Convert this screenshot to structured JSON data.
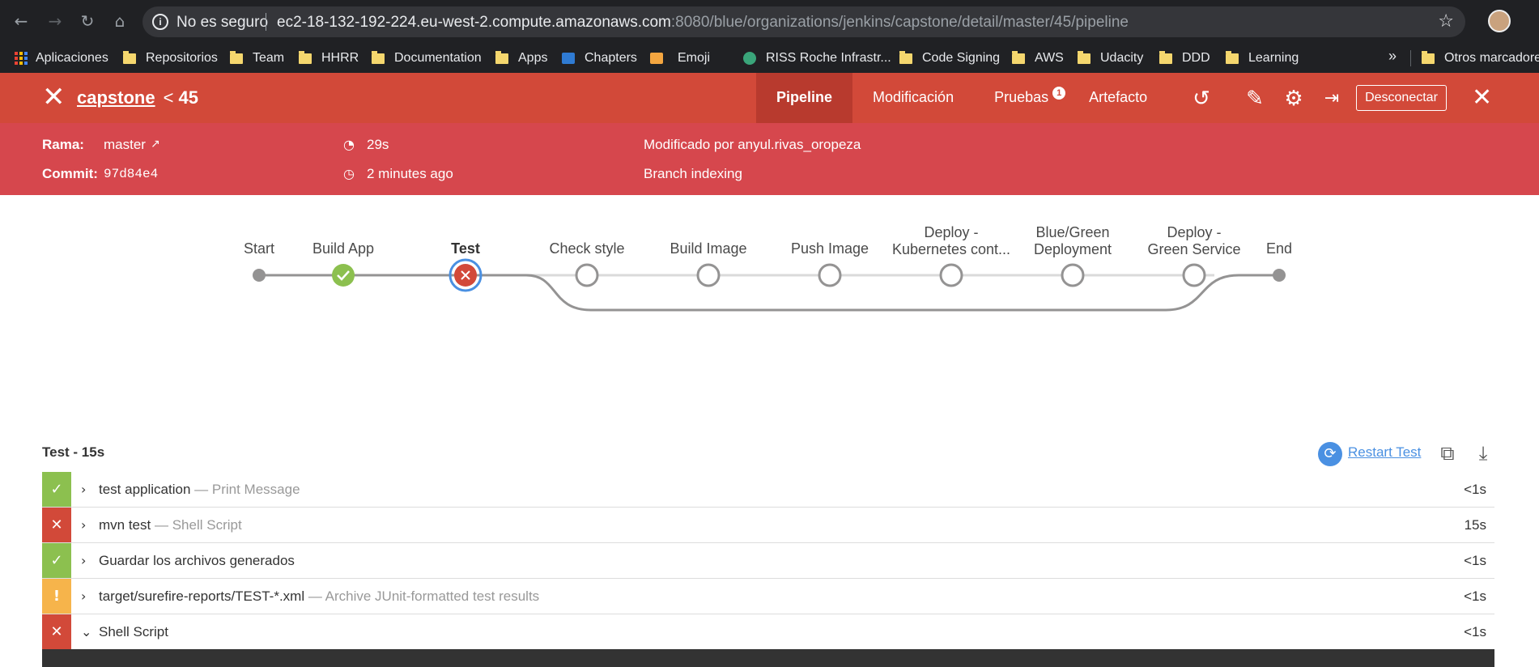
{
  "browser": {
    "insecure_label": "No es seguro",
    "url_host": "ec2-18-132-192-224.eu-west-2.compute.amazonaws.com",
    "url_path": ":8080/blue/organizations/jenkins/capstone/detail/master/45/pipeline",
    "bookmarks": [
      {
        "label": "Aplicaciones",
        "icon": "apps-grid-icon"
      },
      {
        "label": "Repositorios",
        "icon": "folder-icon"
      },
      {
        "label": "Team",
        "icon": "folder-icon"
      },
      {
        "label": "HHRR",
        "icon": "folder-icon"
      },
      {
        "label": "Documentation",
        "icon": "folder-icon"
      },
      {
        "label": "Apps",
        "icon": "folder-icon"
      },
      {
        "label": "Chapters",
        "icon": "site-icon"
      },
      {
        "label": "Emoji",
        "icon": "site-icon"
      },
      {
        "label": "RISS Roche Infrastr...",
        "icon": "site-icon"
      },
      {
        "label": "Code Signing",
        "icon": "folder-icon"
      },
      {
        "label": "AWS",
        "icon": "folder-icon"
      },
      {
        "label": "Udacity",
        "icon": "folder-icon"
      },
      {
        "label": "DDD",
        "icon": "folder-icon"
      },
      {
        "label": "Learning",
        "icon": "folder-icon"
      }
    ],
    "other_bookmarks": "Otros marcadores",
    "more_chevron": "»"
  },
  "header": {
    "pipeline_name": "capstone",
    "separator": "<",
    "run_number": "45",
    "tabs": [
      {
        "label": "Pipeline",
        "active": true
      },
      {
        "label": "Modificación",
        "active": false
      },
      {
        "label": "Pruebas",
        "active": false,
        "badge": "1"
      },
      {
        "label": "Artefacto",
        "active": false
      }
    ],
    "logout_label": "Desconectar",
    "accent_color": "#d24939",
    "meta_color": "#d6474d"
  },
  "meta": {
    "branch_label": "Rama:",
    "branch_value": "master",
    "commit_label": "Commit:",
    "commit_value": "97d84e4",
    "duration": "29s",
    "started": "2 minutes ago",
    "changed_by": "Modificado por anyul.rivas_oropeza",
    "cause": "Branch indexing"
  },
  "pipeline": {
    "stages": [
      {
        "label": "Start",
        "status": "start"
      },
      {
        "label": "Build App",
        "status": "success"
      },
      {
        "label": "Test",
        "status": "failure",
        "selected": true
      },
      {
        "label": "Check style",
        "status": "not-built"
      },
      {
        "label": "Build Image",
        "status": "not-built"
      },
      {
        "label": "Push Image",
        "status": "not-built"
      },
      {
        "label": "Deploy - Kubernetes cont...",
        "status": "not-built"
      },
      {
        "label": "Blue/Green Deployment",
        "status": "not-built"
      },
      {
        "label": "Deploy - Green Service",
        "status": "not-built"
      },
      {
        "label": "End",
        "status": "end"
      }
    ],
    "colors": {
      "success": "#8cc04f",
      "failure": "#d24939",
      "selected_ring": "#4a90e2",
      "line": "#949393",
      "inactive_line": "#dadada"
    }
  },
  "steps_section": {
    "title": "Test - 15s",
    "restart_label": "Restart Test",
    "steps": [
      {
        "name": "test application",
        "desc": "— Print Message",
        "duration": "<1s",
        "status": "success",
        "chevron": "›",
        "status_glyph": "✓"
      },
      {
        "name": "mvn test",
        "desc": "— Shell Script",
        "duration": "15s",
        "status": "failure",
        "chevron": "›",
        "status_glyph": "✕"
      },
      {
        "name": "Guardar los archivos generados",
        "desc": "",
        "duration": "<1s",
        "status": "success",
        "chevron": "›",
        "status_glyph": "✓"
      },
      {
        "name": "target/surefire-reports/TEST-*.xml",
        "desc": "— Archive JUnit-formatted test results",
        "duration": "<1s",
        "status": "unstable",
        "chevron": "›",
        "status_glyph": "!"
      },
      {
        "name": "Shell Script",
        "desc": "",
        "duration": "<1s",
        "status": "failure",
        "chevron": "⌄",
        "status_glyph": "✕"
      }
    ],
    "status_colors": {
      "success": "#8cc04f",
      "failure": "#d24939",
      "unstable": "#f6b44b"
    }
  }
}
